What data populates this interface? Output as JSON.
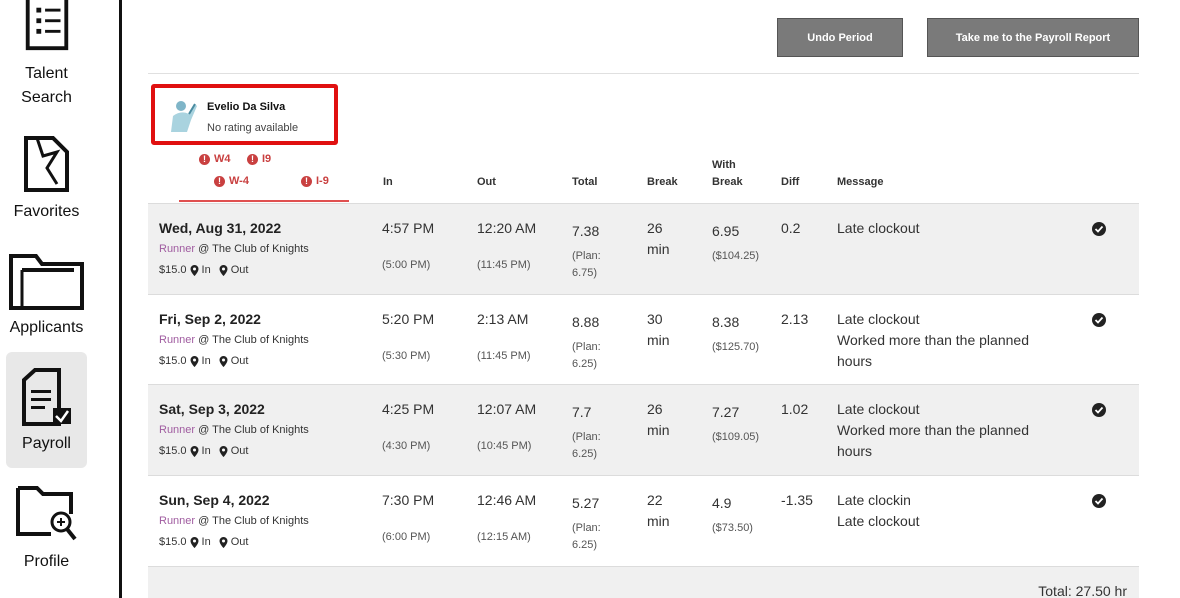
{
  "sidebar": {
    "items": [
      {
        "label_line1": "Talent",
        "label_line2": "Search",
        "icon": "list-document-icon"
      },
      {
        "label": "Favorites",
        "icon": "folder-bookmark-icon"
      },
      {
        "label": "Applicants",
        "icon": "folder-icon"
      },
      {
        "label": "Payroll",
        "icon": "payroll-document-icon",
        "active": true
      },
      {
        "label": "Profile",
        "icon": "folder-search-icon"
      }
    ]
  },
  "header": {
    "undo_label": "Undo Period",
    "payroll_report_label": "Take me to the Payroll Report"
  },
  "employee": {
    "name": "Evelio Da Silva",
    "rating": "No rating available",
    "docs_row1": [
      "W4",
      "I9"
    ],
    "docs_row2": [
      "W-4",
      "I-9"
    ]
  },
  "columns": {
    "in": "In",
    "out": "Out",
    "total": "Total",
    "break": "Break",
    "with_break_1": "With",
    "with_break_2": "Break",
    "diff": "Diff",
    "message": "Message"
  },
  "rows": [
    {
      "date": "Wed, Aug 31, 2022",
      "role": "Runner",
      "venue": " @ The Club of Knights",
      "rate": "$15.0",
      "in_label": "In",
      "out_label": "Out",
      "in": "4:57 PM",
      "in_planned": "(5:00 PM)",
      "out": "12:20 AM",
      "out_planned": "(11:45 PM)",
      "total": "7.38",
      "plan1": "(Plan:",
      "plan2": "6.75)",
      "break1": "26",
      "break2": "min",
      "with_break": "6.95",
      "pay": "($104.25)",
      "diff": "0.2",
      "messages": [
        "Late clockout"
      ]
    },
    {
      "date": "Fri, Sep 2, 2022",
      "role": "Runner",
      "venue": " @ The Club of Knights",
      "rate": "$15.0",
      "in_label": "In",
      "out_label": "Out",
      "in": "5:20 PM",
      "in_planned": "(5:30 PM)",
      "out": "2:13 AM",
      "out_planned": "(11:45 PM)",
      "total": "8.88",
      "plan1": "(Plan:",
      "plan2": "6.25)",
      "break1": "30",
      "break2": "min",
      "with_break": "8.38",
      "pay": "($125.70)",
      "diff": "2.13",
      "messages": [
        "Late clockout",
        "Worked more than the planned",
        "hours"
      ]
    },
    {
      "date": "Sat, Sep 3, 2022",
      "role": "Runner",
      "venue": " @ The Club of Knights",
      "rate": "$15.0",
      "in_label": "In",
      "out_label": "Out",
      "in": "4:25 PM",
      "in_planned": "(4:30 PM)",
      "out": "12:07 AM",
      "out_planned": "(10:45 PM)",
      "total": "7.7",
      "plan1": "(Plan:",
      "plan2": "6.25)",
      "break1": "26",
      "break2": "min",
      "with_break": "7.27",
      "pay": "($109.05)",
      "diff": "1.02",
      "messages": [
        "Late clockout",
        "Worked more than the planned",
        "hours"
      ]
    },
    {
      "date": "Sun, Sep 4, 2022",
      "role": "Runner",
      "venue": " @ The Club of Knights",
      "rate": "$15.0",
      "in_label": "In",
      "out_label": "Out",
      "in": "7:30 PM",
      "in_planned": "(6:00 PM)",
      "out": "12:46 AM",
      "out_planned": "(12:15 AM)",
      "total": "5.27",
      "plan1": "(Plan:",
      "plan2": "6.25)",
      "break1": "22",
      "break2": "min",
      "with_break": "4.9",
      "pay": "($73.50)",
      "diff": "-1.35",
      "messages": [
        "Late clockin",
        "Late clockout"
      ]
    }
  ],
  "footer": {
    "total": "Total: 27.50 hr"
  },
  "colors": {
    "button_bg": "#7a7a7a",
    "highlight_border": "#e01010",
    "doc_warning": "#c94040",
    "role_text": "#a05ca0",
    "row_shade": "#f0f0f0"
  }
}
